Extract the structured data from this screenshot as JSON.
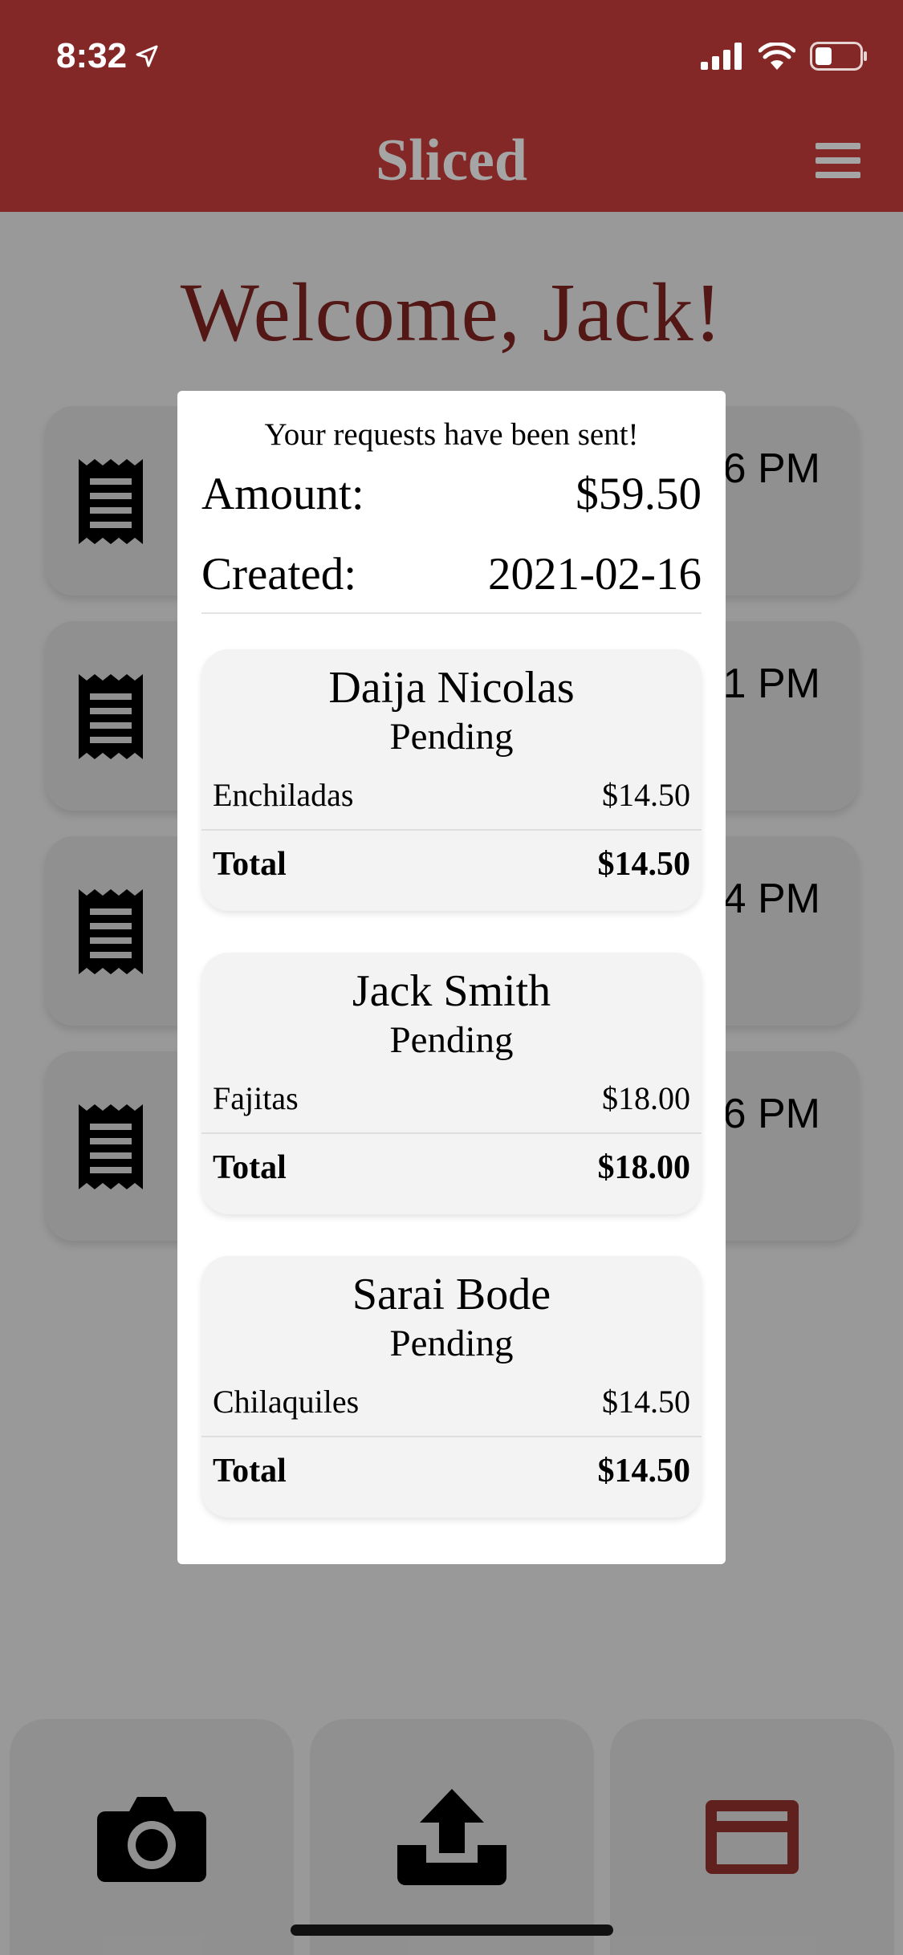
{
  "status_bar": {
    "time": "8:32"
  },
  "header": {
    "title": "Sliced"
  },
  "welcome": "Welcome, Jack!",
  "receipts": [
    {
      "time": "6 PM"
    },
    {
      "time": "1 PM"
    },
    {
      "time": "4 PM"
    },
    {
      "time": "6 PM"
    }
  ],
  "modal": {
    "message": "Your requests have been sent!",
    "amount_label": "Amount:",
    "amount_value": "$59.50",
    "created_label": "Created:",
    "created_value": "2021-02-16",
    "requests": [
      {
        "name": "Daija Nicolas",
        "status": "Pending",
        "item": "Enchiladas",
        "item_price": "$14.50",
        "total_label": "Total",
        "total": "$14.50"
      },
      {
        "name": "Jack Smith",
        "status": "Pending",
        "item": "Fajitas",
        "item_price": "$18.00",
        "total_label": "Total",
        "total": "$18.00"
      },
      {
        "name": "Sarai Bode",
        "status": "Pending",
        "item": "Chilaquiles",
        "item_price": "$14.50",
        "total_label": "Total",
        "total": "$14.50"
      }
    ]
  },
  "tabbar": {
    "items": [
      {
        "icon": "camera-icon"
      },
      {
        "icon": "upload-icon"
      },
      {
        "icon": "credit-card-icon",
        "active": true
      }
    ]
  },
  "colors": {
    "brand": "#832826",
    "welcome": "#8a2826",
    "header_title": "#a5a5a5",
    "card_accent": "#a03632"
  }
}
